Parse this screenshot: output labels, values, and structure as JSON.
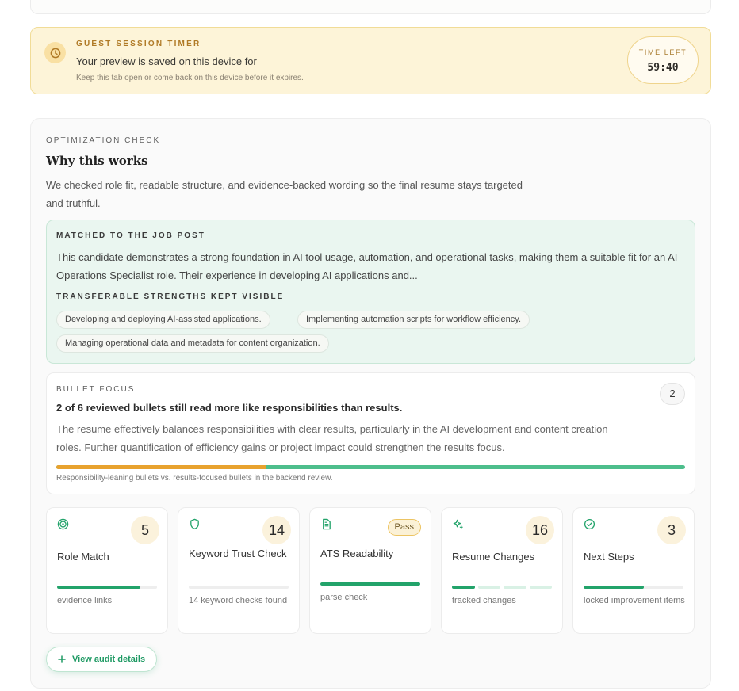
{
  "timer": {
    "kicker": "GUEST SESSION TIMER",
    "title": "Your preview is saved on this device for",
    "subtitle": "Keep this tab open or come back on this device before it expires.",
    "time_left_label": "TIME LEFT",
    "time_left_value": "59:40",
    "icon": "clock-icon"
  },
  "optimization": {
    "kicker": "OPTIMIZATION CHECK",
    "title": "Why this works",
    "description": "We checked role fit, readable structure, and evidence-backed wording so the final resume stays targeted and truthful.",
    "matched": {
      "kicker": "MATCHED TO THE JOB POST",
      "text": "This candidate demonstrates a strong foundation in AI tool usage, automation, and operational tasks, making them a suitable fit for an AI Operations Specialist role. Their experience in developing AI applications and...",
      "strengths_kicker": "TRANSFERABLE STRENGTHS KEPT VISIBLE",
      "strengths": [
        "Developing and deploying AI-assisted applications.",
        "Implementing automation scripts for workflow efficiency.",
        "Managing operational data and metadata for content organization."
      ]
    },
    "bullet_focus": {
      "kicker": "BULLET FOCUS",
      "count": "2",
      "title": "2 of 6 reviewed bullets still read more like responsibilities than results.",
      "text": "The resume effectively balances responsibilities with clear results, particularly in the AI development and content creation roles. Further quantification of efficiency gains or project impact could strengthen the results focus.",
      "responsibility_fraction": 0.333,
      "caption": "Responsibility-leaning bullets vs. results-focused bullets in the backend review."
    },
    "cards": [
      {
        "icon": "target-icon",
        "value": "5",
        "title": "Role Match",
        "sub": "evidence links",
        "progress": 0.83
      },
      {
        "icon": "shield-icon",
        "value": "14",
        "title": "Keyword Trust Check",
        "sub": "14 keyword checks found",
        "progress": 0.0
      },
      {
        "icon": "document-icon",
        "badge": "Pass",
        "title": "ATS Readability",
        "sub": "parse check",
        "progress": 1.0
      },
      {
        "icon": "sparkle-icon",
        "value": "16",
        "title": "Resume Changes",
        "sub": "tracked changes",
        "segments_on": 1,
        "segments_total": 4
      },
      {
        "icon": "check-circle-icon",
        "value": "3",
        "title": "Next Steps",
        "sub": "locked improvement items",
        "progress": 0.6
      }
    ],
    "audit_button": "View audit details"
  },
  "colors": {
    "accent_green": "#22a36a",
    "timer_background": "#fdf4d8",
    "matched_background": "#eaf6f0",
    "responsibility_orange": "#e8a22e"
  }
}
